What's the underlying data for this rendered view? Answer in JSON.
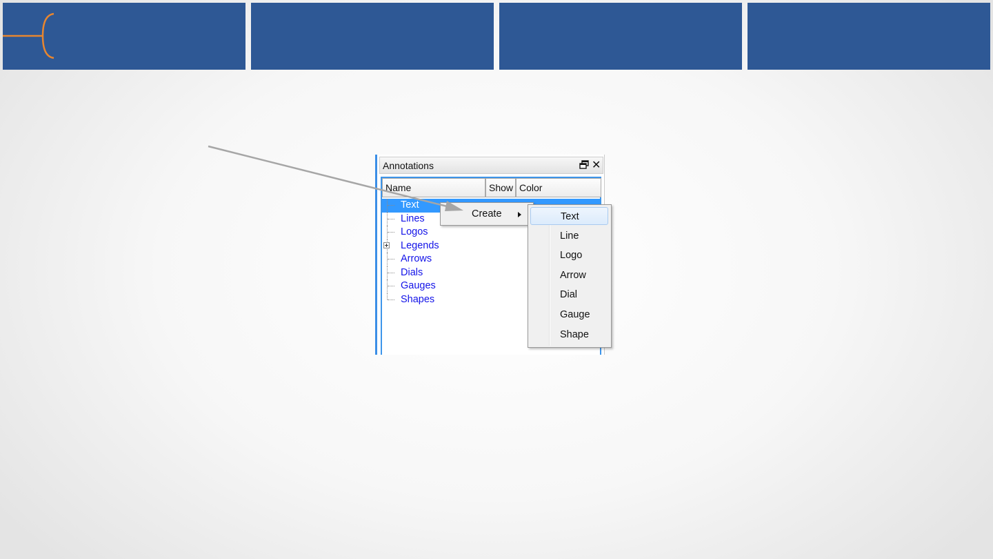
{
  "panel": {
    "title": "Annotations",
    "columns": [
      "Name",
      "Show",
      "Color"
    ],
    "tree_items": [
      {
        "label": "Text",
        "selected": true,
        "expandable": false
      },
      {
        "label": "Lines",
        "selected": false,
        "expandable": false
      },
      {
        "label": "Logos",
        "selected": false,
        "expandable": false
      },
      {
        "label": "Legends",
        "selected": false,
        "expandable": true
      },
      {
        "label": "Arrows",
        "selected": false,
        "expandable": false
      },
      {
        "label": "Dials",
        "selected": false,
        "expandable": false
      },
      {
        "label": "Gauges",
        "selected": false,
        "expandable": false
      },
      {
        "label": "Shapes",
        "selected": false,
        "expandable": false
      }
    ],
    "float_icon": "float-window-icon",
    "close_icon": "close-icon",
    "close_glyph": "✕"
  },
  "context_menu": {
    "create_label": "Create",
    "submenu_icon": "chevron-right-icon"
  },
  "submenu": {
    "items": [
      "Text",
      "Line",
      "Logo",
      "Arrow",
      "Dial",
      "Gauge",
      "Shape"
    ],
    "highlighted": "Text"
  },
  "colors": {
    "banner": "#2e5895",
    "accent_orange": "#e8862f",
    "selection": "#3399ff",
    "tree_text": "#1313e8",
    "pointer_arrow": "#a6a6a6"
  }
}
